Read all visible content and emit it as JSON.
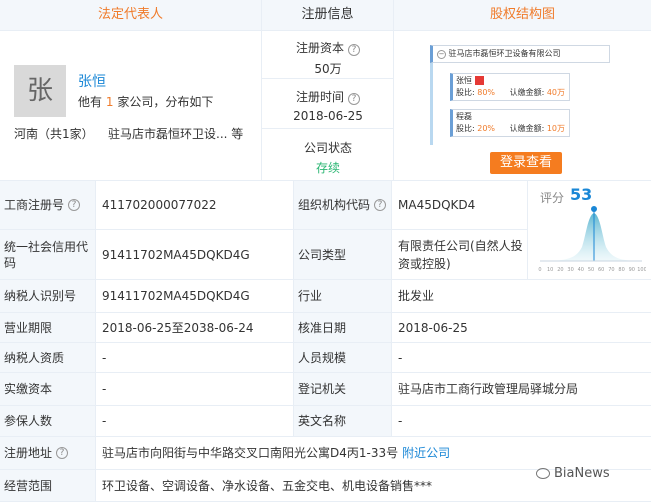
{
  "headers": {
    "legal_rep": "法定代表人",
    "reg_info": "注册信息",
    "equity": "股权结构图"
  },
  "legal_rep": {
    "avatar_char": "张",
    "name": "张恒",
    "company_prefix": "他有",
    "company_count": "1",
    "company_suffix": "家公司，分布如下",
    "region": "河南（共1家）",
    "company_name": "驻马店市磊恒环卫设...",
    "etc": "等"
  },
  "reg_info": {
    "capital_label": "注册资本",
    "capital_value": "50万",
    "date_label": "注册时间",
    "date_value": "2018-06-25",
    "status_label": "公司状态",
    "status_value": "存续"
  },
  "equity": {
    "company": "驻马店市磊恒环卫设备有限公司",
    "holders": [
      {
        "name": "张恒",
        "ratio_label": "股比:",
        "ratio": "80%",
        "amount_label": "认缴金额:",
        "amount": "40万"
      },
      {
        "name": "程磊",
        "ratio_label": "股比:",
        "ratio": "20%",
        "amount_label": "认缴金额:",
        "amount": "10万"
      }
    ],
    "login_button": "登录查看"
  },
  "score": {
    "label": "评分",
    "value": "53",
    "ticks": [
      "0",
      "10",
      "20",
      "30",
      "40",
      "50",
      "60",
      "70",
      "80",
      "90",
      "100"
    ]
  },
  "rows": [
    {
      "l1": "工商注册号",
      "v1": "411702000077022",
      "l2": "组织机构代码",
      "v2": "MA45DQKD4"
    },
    {
      "l1": "统一社会信用代码",
      "v1": "91411702MA45DQKD4G",
      "l2": "公司类型",
      "v2": "有限责任公司(自然人投资或控股)"
    },
    {
      "l1": "纳税人识别号",
      "v1": "91411702MA45DQKD4G",
      "l2": "行业",
      "v2": "批发业"
    },
    {
      "l1": "营业期限",
      "v1": "2018-06-25至2038-06-24",
      "l2": "核准日期",
      "v2": "2018-06-25"
    },
    {
      "l1": "纳税人资质",
      "v1": "-",
      "l2": "人员规模",
      "v2": "-"
    },
    {
      "l1": "实缴资本",
      "v1": "-",
      "l2": "登记机关",
      "v2": "驻马店市工商行政管理局驿城分局"
    },
    {
      "l1": "参保人数",
      "v1": "-",
      "l2": "英文名称",
      "v2": "-"
    }
  ],
  "address": {
    "label": "注册地址",
    "value": "驻马店市向阳街与中华路交叉口南阳光公寓D4丙1-33号",
    "link": "附近公司"
  },
  "scope": {
    "label": "经营范围",
    "value": "环卫设备、空调设备、净水设备、五金交电、机电设备销售***"
  },
  "watermark": "BiaNews",
  "colors": {
    "accent": "#f07b2a",
    "link": "#1a87d6",
    "status": "#2bb673",
    "label_bg": "#f3f7fb"
  }
}
